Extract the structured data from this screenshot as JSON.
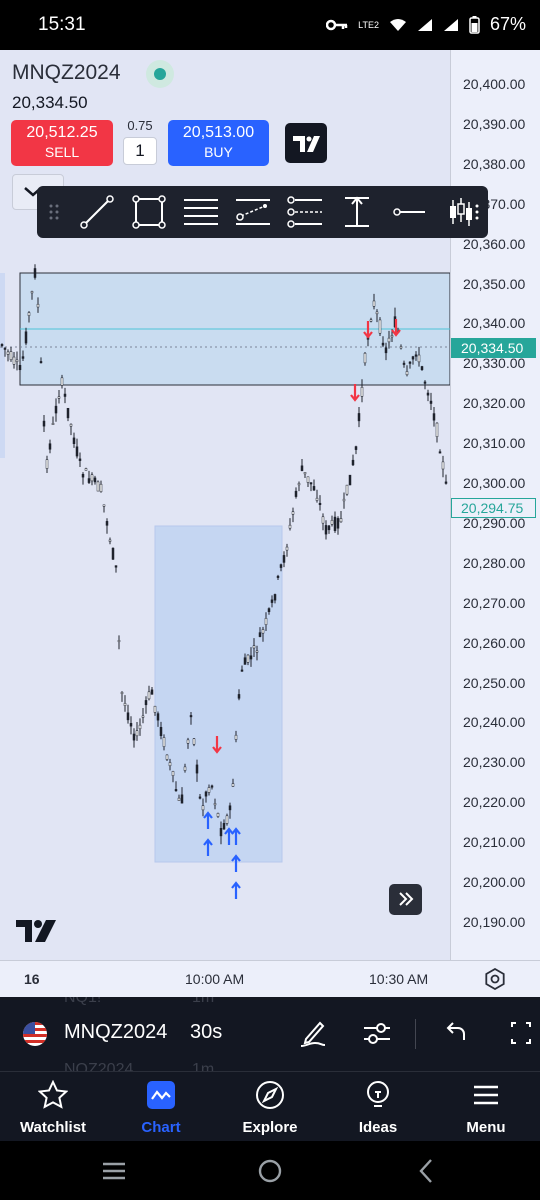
{
  "status_bar": {
    "time": "15:31",
    "battery": "67%",
    "network": "LTE2"
  },
  "chart": {
    "symbol": "MNQZ2024",
    "last_price": "20,334.50",
    "sell": {
      "price": "20,512.25",
      "label": "SELL"
    },
    "buy": {
      "price": "20,513.00",
      "label": "BUY"
    },
    "spread": "0.75",
    "quantity": "1",
    "price_axis": [
      "20,400.00",
      "20,390.00",
      "20,380.00",
      "20,370.00",
      "20,360.00",
      "20,350.00",
      "20,340.00",
      "20,330.00",
      "20,320.00",
      "20,310.00",
      "20,300.00",
      "20,290.00",
      "20,280.00",
      "20,270.00",
      "20,260.00",
      "20,250.00",
      "20,240.00",
      "20,230.00",
      "20,220.00",
      "20,210.00",
      "20,200.00",
      "20,190.00"
    ],
    "current_price_tag": "20,334.50",
    "secondary_price_tag": "20,294.75",
    "time_axis": [
      "16",
      "10:00 AM",
      "10:30 AM"
    ],
    "colors": {
      "up": "#26a69a",
      "down": "#f23645",
      "accent": "#2962ff",
      "candle": "#1e222d"
    }
  },
  "drawing_toolbar": {
    "tools": [
      "drag-handle-icon",
      "trend-line-icon",
      "rectangle-icon",
      "horizontal-lines-icon",
      "parallel-channel-icon",
      "pitchfork-icon",
      "price-range-icon",
      "horizontal-ray-icon",
      "indicator-icon"
    ]
  },
  "bottom_strip": {
    "symbol": "MNQZ2024",
    "interval": "30s",
    "ghost_top": "NQ1!",
    "ghost_top_interval": "1m",
    "ghost_bottom": "NQZ2024",
    "ghost_bottom_interval": "1m"
  },
  "nav": {
    "items": [
      {
        "label": "Watchlist",
        "icon": "star-icon"
      },
      {
        "label": "Chart",
        "icon": "chart-icon"
      },
      {
        "label": "Explore",
        "icon": "compass-icon"
      },
      {
        "label": "Ideas",
        "icon": "lightbulb-icon"
      },
      {
        "label": "Menu",
        "icon": "menu-icon"
      }
    ],
    "active": "Chart"
  }
}
